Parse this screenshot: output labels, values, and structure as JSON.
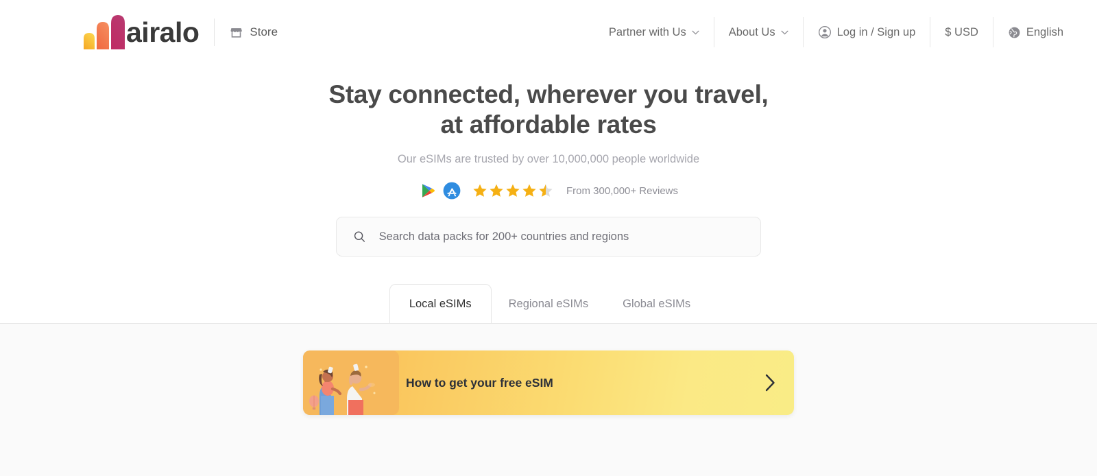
{
  "header": {
    "brand_name": "airalo",
    "store_label": "Store",
    "store_icon": "storefront-icon",
    "nav": [
      {
        "label": "Partner with Us",
        "icon": "chevron-down-icon",
        "has_chevron": true
      },
      {
        "label": "About Us",
        "icon": "chevron-down-icon",
        "has_chevron": true
      },
      {
        "label": "Log in / Sign up",
        "icon": "user-account-icon",
        "has_chevron": false
      },
      {
        "label": "$ USD",
        "icon": "",
        "has_chevron": false
      },
      {
        "label": "English",
        "icon": "globe-icon",
        "has_chevron": false
      }
    ]
  },
  "hero": {
    "headline_line1": "Stay connected, wherever you travel,",
    "headline_line2": "at affordable rates",
    "subtitle": "Our eSIMs are trusted by over 10,000,000 people worldwide",
    "rating": {
      "google_play_icon": "google-play-icon",
      "app_store_icon": "app-store-icon",
      "stars_value": 4.5,
      "stars_total": 5,
      "star_color": "#f5b014",
      "star_empty_color": "#dcdcdc",
      "reviews_text": "From 300,000+ Reviews"
    },
    "search": {
      "icon": "search-icon",
      "placeholder": "Search data packs for 200+ countries and regions",
      "value": ""
    },
    "tabs": [
      {
        "label": "Local eSIMs",
        "active": true
      },
      {
        "label": "Regional eSIMs",
        "active": false
      },
      {
        "label": "Global eSIMs",
        "active": false
      }
    ]
  },
  "promo": {
    "title": "How to get your free eSIM",
    "arrow_icon": "chevron-right-icon",
    "illustration": "two-people-celebrating-with-phones-illustration",
    "gradient_start": "#f7b955",
    "gradient_end": "#f9ec86"
  }
}
